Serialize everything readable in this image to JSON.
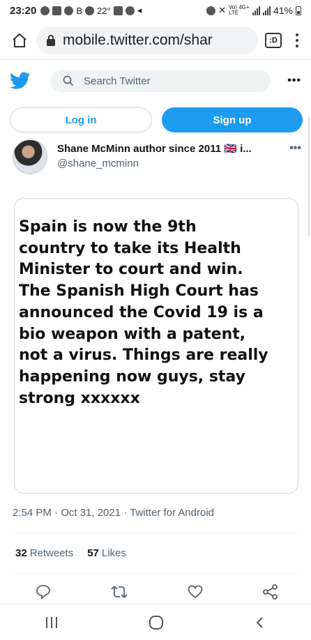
{
  "status_bar": {
    "time": "23:20",
    "b_label": "B",
    "temperature": "22°",
    "network_labels": "Vo) 4G+ LTE",
    "battery": "41%"
  },
  "browser": {
    "url": "mobile.twitter.com/shar",
    "tabs_label": ":D"
  },
  "twitter_header": {
    "search_placeholder": "Search Twitter"
  },
  "auth": {
    "login": "Log in",
    "signup": "Sign up"
  },
  "author": {
    "name": "Shane McMinn author since 2011 🇬🇧 i...",
    "handle": "@shane_mcminn"
  },
  "tweet": {
    "image_text": "Spain is now the 9th\ncountry to take its Health\nMinister to court and win.\nThe Spanish High Court has\nannounced the Covid 19 is a\nbio weapon with a patent,\nnot a virus. Things are really\nhappening now guys, stay\nstrong xxxxxx",
    "meta": "2:54 PM · Oct 31, 2021 · Twitter for Android"
  },
  "stats": {
    "retweets_count": "32",
    "retweets_label": "Retweets",
    "likes_count": "57",
    "likes_label": "Likes"
  },
  "colors": {
    "twitter_blue": "#1d9bf0",
    "text_primary": "#0f1419",
    "text_secondary": "#536471"
  }
}
